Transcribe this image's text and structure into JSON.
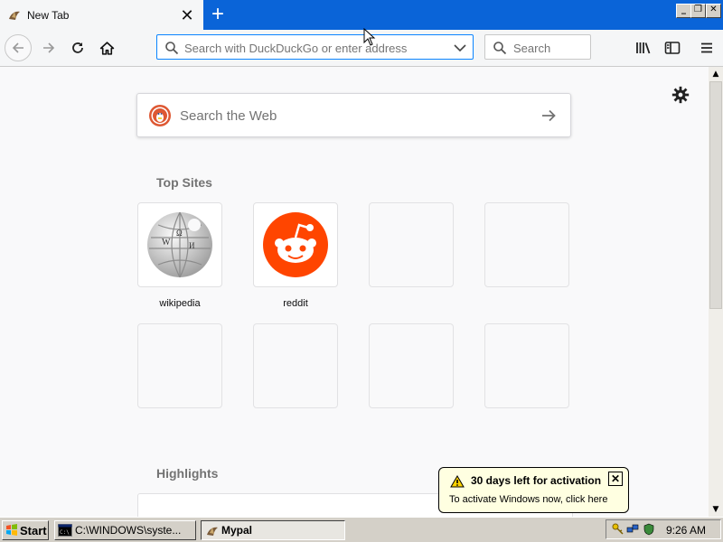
{
  "browser": {
    "tab": {
      "title": "New Tab",
      "icon": "mypal-favicon"
    },
    "new_tab_label": "+",
    "window_controls": {
      "minimize": "_",
      "restore": "❐",
      "close": "✕"
    },
    "urlbar": {
      "placeholder": "Search with DuckDuckGo or enter address"
    },
    "searchbar": {
      "placeholder": "Search"
    },
    "accent_color": "#0a64d8"
  },
  "newtab": {
    "search": {
      "placeholder": "Search the Web"
    },
    "top_sites": {
      "heading": "Top Sites",
      "tiles": [
        {
          "label": "wikipedia",
          "icon": "wikipedia-globe"
        },
        {
          "label": "reddit",
          "icon": "reddit-alien"
        }
      ]
    },
    "highlights": {
      "heading": "Highlights"
    }
  },
  "balloon": {
    "title": "30 days left for activation",
    "text": "To activate Windows now, click here",
    "close_label": "✕"
  },
  "taskbar": {
    "start_label": "Start",
    "items": [
      {
        "label": "C:\\WINDOWS\\syste..."
      },
      {
        "label": "Mypal"
      }
    ],
    "clock": "9:26 AM"
  }
}
